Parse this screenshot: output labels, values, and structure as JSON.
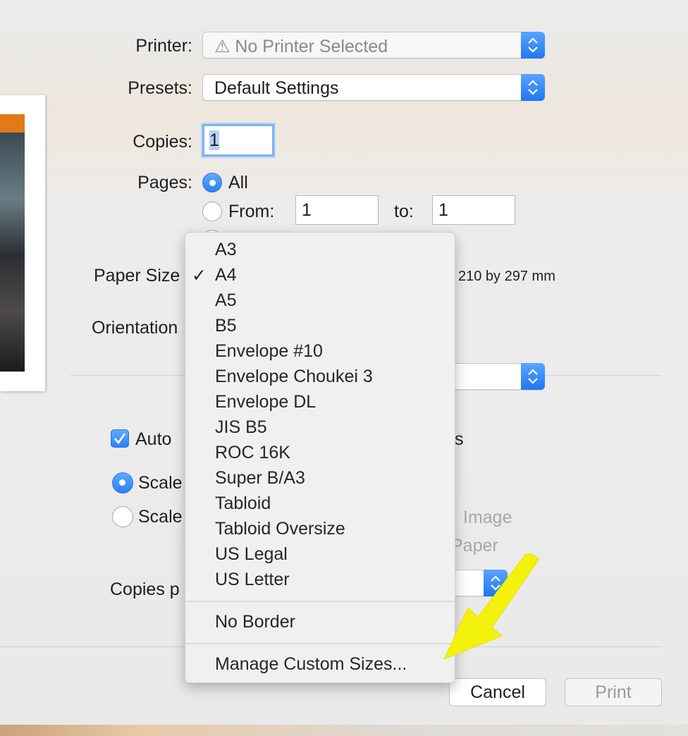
{
  "printer": {
    "label": "Printer:",
    "value": "No Printer Selected"
  },
  "presets": {
    "label": "Presets:",
    "value": "Default Settings"
  },
  "copies": {
    "label": "Copies:",
    "value": "1"
  },
  "pages": {
    "label": "Pages:",
    "all": "All",
    "from": "From:",
    "from_value": "1",
    "to": "to:",
    "to_value": "1"
  },
  "paper_size": {
    "label": "Paper Size",
    "dimensions": "210 by 297 mm"
  },
  "orientation": {
    "label": "Orientation"
  },
  "auto": {
    "label": "Auto",
    "suffix": "s"
  },
  "scale1": {
    "label": "Scale"
  },
  "scale2": {
    "label": "Scale",
    "right1": "Image",
    "right2": "Paper"
  },
  "copies_per": {
    "label": "Copies p"
  },
  "menu": {
    "check": "✓",
    "items": [
      "A3",
      "A4",
      "A5",
      "B5",
      "Envelope #10",
      "Envelope Choukei 3",
      "Envelope DL",
      "JIS B5",
      "ROC 16K",
      "Super B/A3",
      "Tabloid",
      "Tabloid Oversize",
      "US Legal",
      "US Letter"
    ],
    "no_border": "No Border",
    "manage": "Manage Custom Sizes..."
  },
  "buttons": {
    "cancel": "Cancel",
    "print": "Print"
  },
  "colors": {
    "accent": "#2a82f3",
    "arrow": "#f2f20d"
  }
}
